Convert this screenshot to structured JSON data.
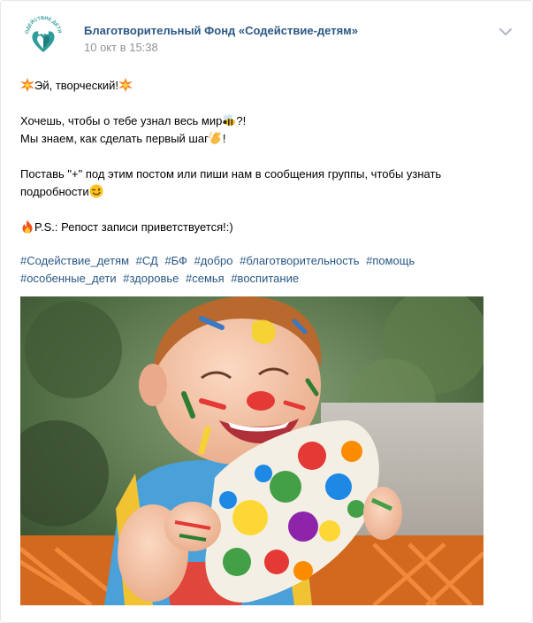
{
  "post": {
    "author": "Благотворительный Фонд «Содействие-детям»",
    "date": "10 окт в 15:38",
    "avatar_text": "СОДЕЙСТВИЕ ДЕТЯМ",
    "icons": {
      "avatar": "heart-hands-logo-icon",
      "more": "chevron-down-icon",
      "boom": "collision-emoji-icon",
      "bee": "bee-emoji-icon",
      "clap": "clapping-hands-emoji-icon",
      "wink": "winking-face-emoji-icon",
      "fire": "fire-emoji-icon"
    },
    "text": {
      "line1": "Эй, творческий!",
      "line2a": "Хочешь, чтобы о тебе узнал весь мир",
      "line2b": "?!",
      "line3a": "Мы знаем, как сделать первый шаг",
      "line3b": "!",
      "line4": "Поставь \"+\" под этим постом или пиши нам в сообщения группы, чтобы узнать",
      "line5": "подробности",
      "line6": "P.S.: Репост записи приветствуется!:)"
    },
    "hashtags": [
      "#Содействие_детям",
      "#СД",
      "#БФ",
      "#добро",
      "#благотворительность",
      "#помощь",
      "#особенные_дети",
      "#здоровье",
      "#семья",
      "#воспитание"
    ]
  },
  "colors": {
    "link": "#2a5885",
    "meta": "#939393",
    "logo": "#3aa3a3"
  }
}
